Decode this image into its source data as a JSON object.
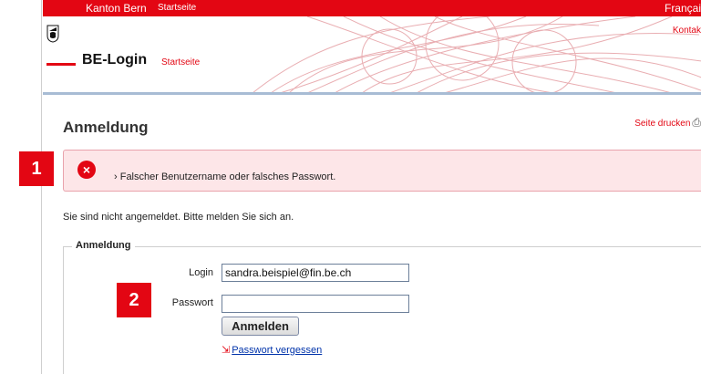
{
  "topbar": {
    "canton": "Kanton Bern",
    "start": "Startseite",
    "lang": "Françai"
  },
  "header": {
    "brand": "BE-Login",
    "start": "Startseite",
    "contact": "Kontak"
  },
  "print": {
    "label": "Seite drucken",
    "icon": "printer-icon"
  },
  "page": {
    "title": "Anmeldung"
  },
  "error": {
    "icon": "error-x-icon",
    "message": "› Falscher Benutzername oder falsches Passwort."
  },
  "badges": [
    "1",
    "2"
  ],
  "info": "Sie sind nicht angemeldet. Bitte melden Sie sich an.",
  "form": {
    "legend": "Anmeldung",
    "login_label": "Login",
    "login_value": "sandra.beispiel@fin.be.ch",
    "password_label": "Passwort",
    "password_value": "",
    "submit_label": "Anmelden",
    "forgot_label": "Passwort vergessen"
  },
  "colors": {
    "brand_red": "#e30613",
    "error_bg": "#fde6e8",
    "link_blue": "#0033aa",
    "header_rule": "#a8bcd4"
  }
}
